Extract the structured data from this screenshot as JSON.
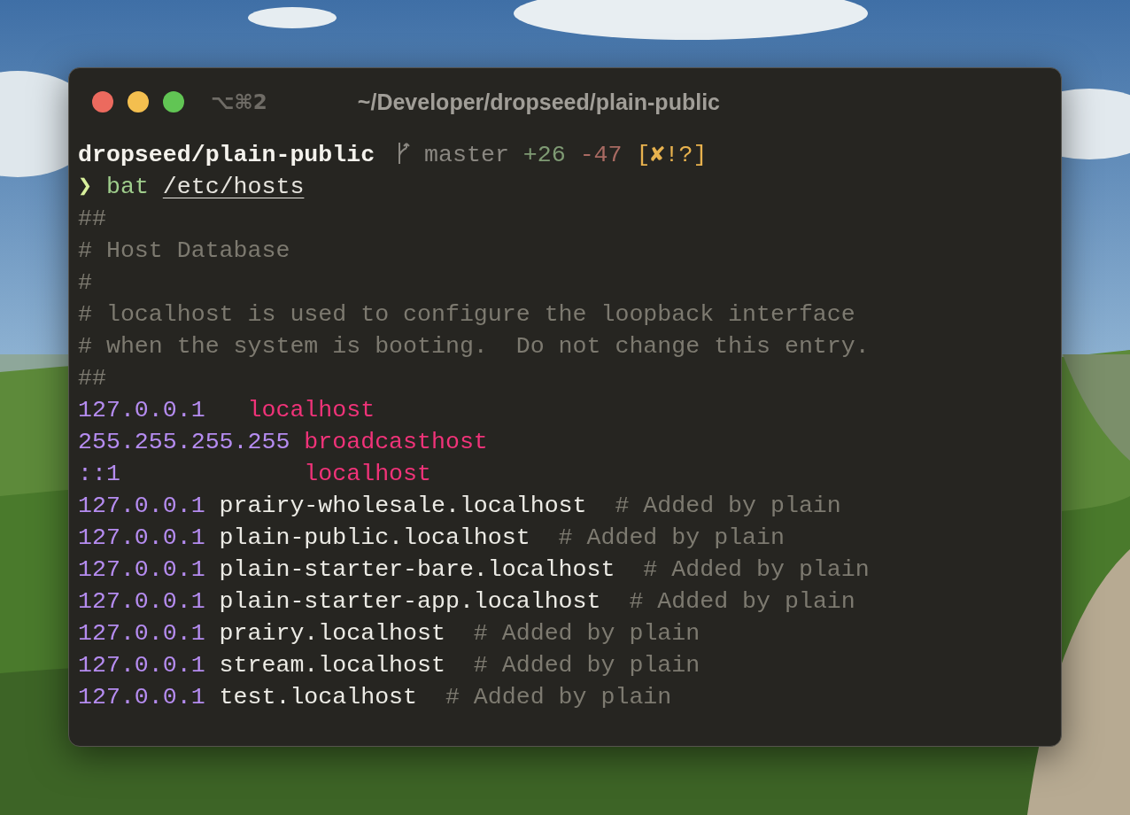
{
  "window": {
    "shortcut": "⌥⌘2",
    "title": "~/Developer/dropseed/plain-public"
  },
  "lines": [
    [
      {
        "kind": "dir",
        "text": "dropseed/plain-public"
      },
      {
        "kind": "branch-icon"
      },
      {
        "kind": "branch",
        "text": " master"
      },
      {
        "kind": "added",
        "text": " +26"
      },
      {
        "kind": "removed",
        "text": " -47"
      },
      {
        "kind": "status",
        "text": " [✘!?]"
      }
    ],
    [
      {
        "kind": "prompt",
        "text": "❯"
      },
      {
        "kind": "command",
        "text": " bat"
      },
      {
        "kind": "arg",
        "text": "/etc/hosts"
      }
    ],
    [
      {
        "kind": "comment",
        "text": "##"
      }
    ],
    [
      {
        "kind": "comment",
        "text": "# Host Database"
      }
    ],
    [
      {
        "kind": "comment",
        "text": "#"
      }
    ],
    [
      {
        "kind": "comment",
        "text": "# localhost is used to configure the loopback interface"
      }
    ],
    [
      {
        "kind": "comment",
        "text": "# when the system is booting.  Do not change this entry."
      }
    ],
    [
      {
        "kind": "comment",
        "text": "##"
      }
    ],
    [
      {
        "kind": "ip",
        "text": "127.0.0.1"
      },
      {
        "kind": "host",
        "text": "   localhost"
      }
    ],
    [
      {
        "kind": "ip",
        "text": "255.255.255.255"
      },
      {
        "kind": "host",
        "text": " broadcasthost"
      }
    ],
    [
      {
        "kind": "ip",
        "text": "::1"
      },
      {
        "kind": "host",
        "text": "             localhost"
      }
    ],
    [
      {
        "kind": "ip",
        "text": "127.0.0.1"
      },
      {
        "kind": "name",
        "text": " prairy-wholesale.localhost"
      },
      {
        "kind": "comment",
        "text": "  # Added by plain"
      }
    ],
    [
      {
        "kind": "ip",
        "text": "127.0.0.1"
      },
      {
        "kind": "name",
        "text": " plain-public.localhost"
      },
      {
        "kind": "comment",
        "text": "  # Added by plain"
      }
    ],
    [
      {
        "kind": "ip",
        "text": "127.0.0.1"
      },
      {
        "kind": "name",
        "text": " plain-starter-bare.localhost"
      },
      {
        "kind": "comment",
        "text": "  # Added by plain"
      }
    ],
    [
      {
        "kind": "ip",
        "text": "127.0.0.1"
      },
      {
        "kind": "name",
        "text": " plain-starter-app.localhost"
      },
      {
        "kind": "comment",
        "text": "  # Added by plain"
      }
    ],
    [
      {
        "kind": "ip",
        "text": "127.0.0.1"
      },
      {
        "kind": "name",
        "text": " prairy.localhost"
      },
      {
        "kind": "comment",
        "text": "  # Added by plain"
      }
    ],
    [
      {
        "kind": "ip",
        "text": "127.0.0.1"
      },
      {
        "kind": "name",
        "text": " stream.localhost"
      },
      {
        "kind": "comment",
        "text": "  # Added by plain"
      }
    ],
    [
      {
        "kind": "ip",
        "text": "127.0.0.1"
      },
      {
        "kind": "name",
        "text": " test.localhost"
      },
      {
        "kind": "comment",
        "text": "  # Added by plain"
      }
    ]
  ]
}
